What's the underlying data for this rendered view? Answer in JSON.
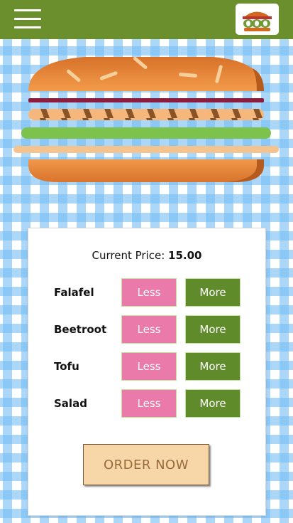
{
  "header": {
    "menu_icon": "hamburger-menu-icon",
    "logo_icon": "burger-logo-icon",
    "bar_color": "#6a8f2c"
  },
  "burger": {
    "layers": [
      "bun-top",
      "onion",
      "falafel",
      "lettuce",
      "tofu",
      "bun-bottom"
    ],
    "colors": {
      "bun": "#e8852f",
      "onion": "#8b1e3f",
      "falafel": "#f1b47a",
      "lettuce": "#7cc24d",
      "tofu": "#f3c48f"
    }
  },
  "order": {
    "price_label": "Current Price:",
    "price_value": "15.00",
    "ingredients": [
      {
        "name": "Falafel",
        "less": "Less",
        "more": "More"
      },
      {
        "name": "Beetroot",
        "less": "Less",
        "more": "More"
      },
      {
        "name": "Tofu",
        "less": "Less",
        "more": "More"
      },
      {
        "name": "Salad",
        "less": "Less",
        "more": "More"
      }
    ],
    "order_button": "ORDER NOW"
  },
  "colors": {
    "less_button": "#e97aa9",
    "more_button": "#5f8b2b",
    "order_button": "#f7d6a8",
    "checker_blue": "#78bef5"
  }
}
